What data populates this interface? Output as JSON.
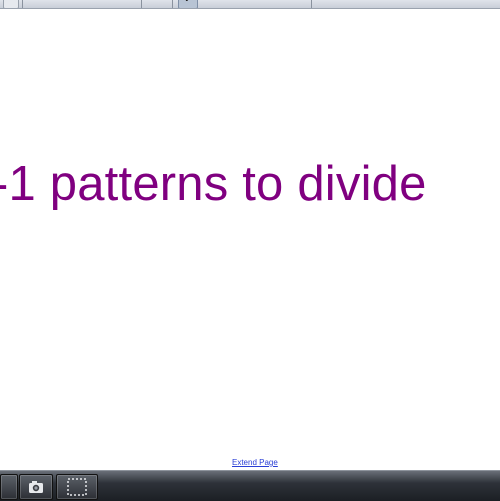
{
  "canvas": {
    "headline": "-1 patterns to divide",
    "headline_color": "#800080",
    "extend_link": "Extend Page"
  },
  "toolbar": {
    "tools": [
      "page-sorter-icon",
      "monitor-icon",
      "monitor-icon",
      "monitor-icon",
      "keyboard-icon",
      "sort-icon",
      "table-icon",
      "select-arrow-icon",
      "pen-icon",
      "creative-pen-icon",
      "highlighter-icon",
      "line-pen-icon",
      "eraser-icon",
      "line-color-icon",
      "line-width-icon",
      "dropdown-chevron-icon"
    ]
  },
  "taskbar": {
    "items": [
      "taskbar-button",
      "camera-icon",
      "screen-capture-icon"
    ]
  }
}
